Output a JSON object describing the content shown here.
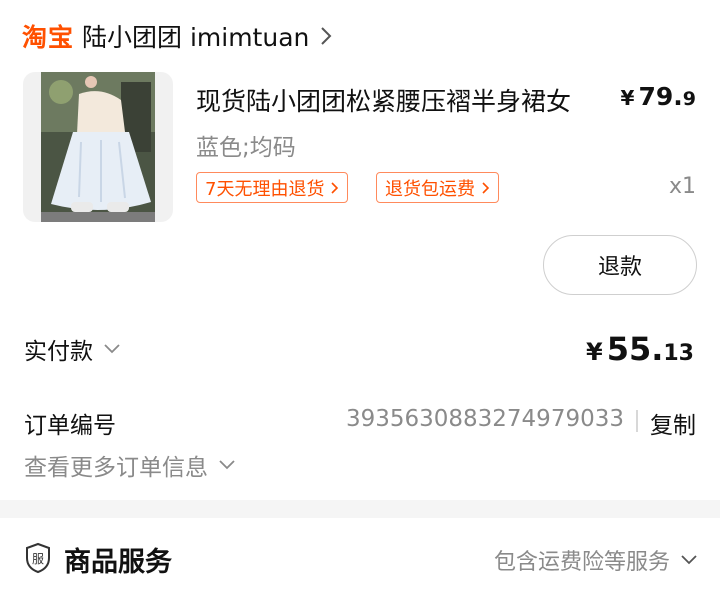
{
  "store": {
    "brand": "淘宝",
    "name": "陆小团团 imimtuan"
  },
  "product": {
    "title": "现货陆小团团松紧腰压褶半身裙女",
    "price_currency": "¥",
    "price_int": "79.",
    "price_dec": "9",
    "sku": "蓝色;均码",
    "tags": [
      "7天无理由退货",
      "退货包运费"
    ],
    "quantity": "x1"
  },
  "actions": {
    "refund_label": "退款"
  },
  "payment": {
    "label": "实付款",
    "currency": "¥",
    "amount_int": "55.",
    "amount_dec": "13"
  },
  "order": {
    "number_label": "订单编号",
    "number": "3935630883274979033",
    "copy_label": "复制",
    "more_label": "查看更多订单信息"
  },
  "service": {
    "title": "商品服务",
    "summary": "包含运费险等服务"
  },
  "colors": {
    "accent": "#ff5000",
    "muted_text": "#8a8a8a"
  }
}
